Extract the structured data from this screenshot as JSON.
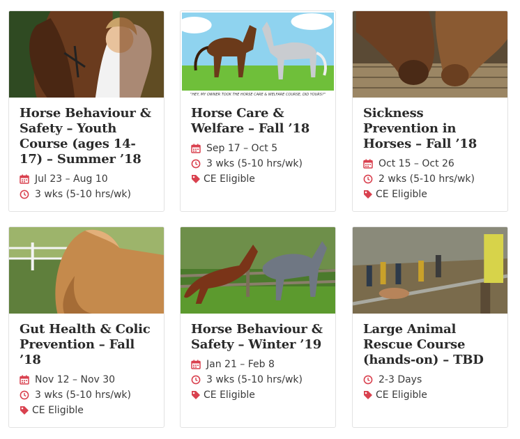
{
  "icons": {
    "calendar": "calendar-icon",
    "clock": "clock-icon",
    "tag": "tag-icon"
  },
  "colors": {
    "accent": "#d9414f",
    "title": "#2a2a2a",
    "text": "#3a3a3a"
  },
  "courses": [
    {
      "title": "Horse Behaviour & Safety – Youth Course (ages 14-17) – Summer ’18",
      "dates": "Jul 23 – Aug 10",
      "duration": "3 wks (5-10 hrs/wk)"
    },
    {
      "title": "Horse Care & Welfare – Fall ’18",
      "dates": "Sep 17 – Oct 5",
      "duration": "3 wks (5-10 hrs/wk)",
      "badge": "CE Eligible",
      "image_caption": "\"HEY, MY OWNER TOOK THE HORSE CARE & WELFARE COURSE, DID YOURS?\""
    },
    {
      "title": "Sickness Prevention in Horses – Fall ’18",
      "dates": "Oct 15 – Oct 26",
      "duration": "2 wks (5-10 hrs/wk)",
      "badge": "CE Eligible"
    },
    {
      "title": "Gut Health & Colic Prevention – Fall ’18",
      "dates": "Nov 12 – Nov 30",
      "duration": "3 wks (5-10 hrs/wk)",
      "badge": "CE Eligible"
    },
    {
      "title": "Horse Behaviour & Safety – Winter ’19",
      "dates": "Jan 21 – Feb 8",
      "duration": "3 wks (5-10 hrs/wk)",
      "badge": "CE Eligible"
    },
    {
      "title": "Large Animal Rescue Course (hands-on) – TBD",
      "duration": "2-3 Days",
      "badge": "CE Eligible"
    }
  ]
}
